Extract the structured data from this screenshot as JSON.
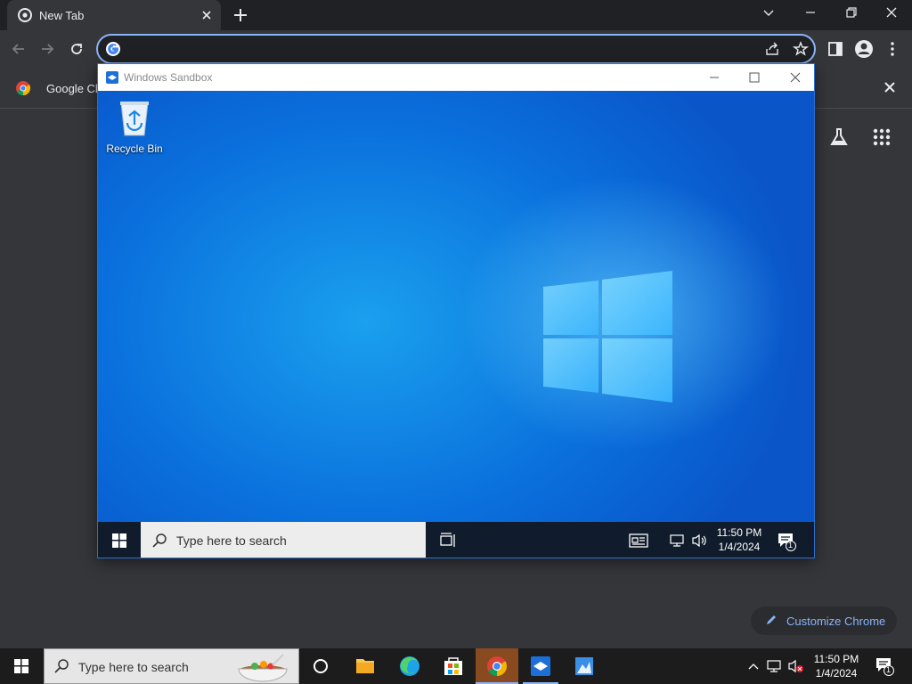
{
  "chrome": {
    "tab_title": "New Tab",
    "omnibox_value": "",
    "bookmark_label": "Google Ch",
    "customize_label": "Customize Chrome"
  },
  "sandbox": {
    "window_title": "Windows Sandbox",
    "desktop_icon_label": "Recycle Bin",
    "search_placeholder": "Type here to search",
    "clock_time": "11:50 PM",
    "clock_date": "1/4/2024",
    "notification_count": "1"
  },
  "taskbar": {
    "search_placeholder": "Type here to search",
    "clock_time": "11:50 PM",
    "clock_date": "1/4/2024",
    "notification_count": "1",
    "apps": [
      "cortana-circle-icon",
      "file-explorer-icon",
      "edge-icon",
      "microsoft-store-icon",
      "chrome-icon",
      "windows-sandbox-icon",
      "paint-icon"
    ]
  },
  "colors": {
    "accent": "#8ab4f8",
    "chrome_dark": "#202124",
    "chrome_surface": "#35363a",
    "desktop_blue": "#0a6fdc"
  }
}
